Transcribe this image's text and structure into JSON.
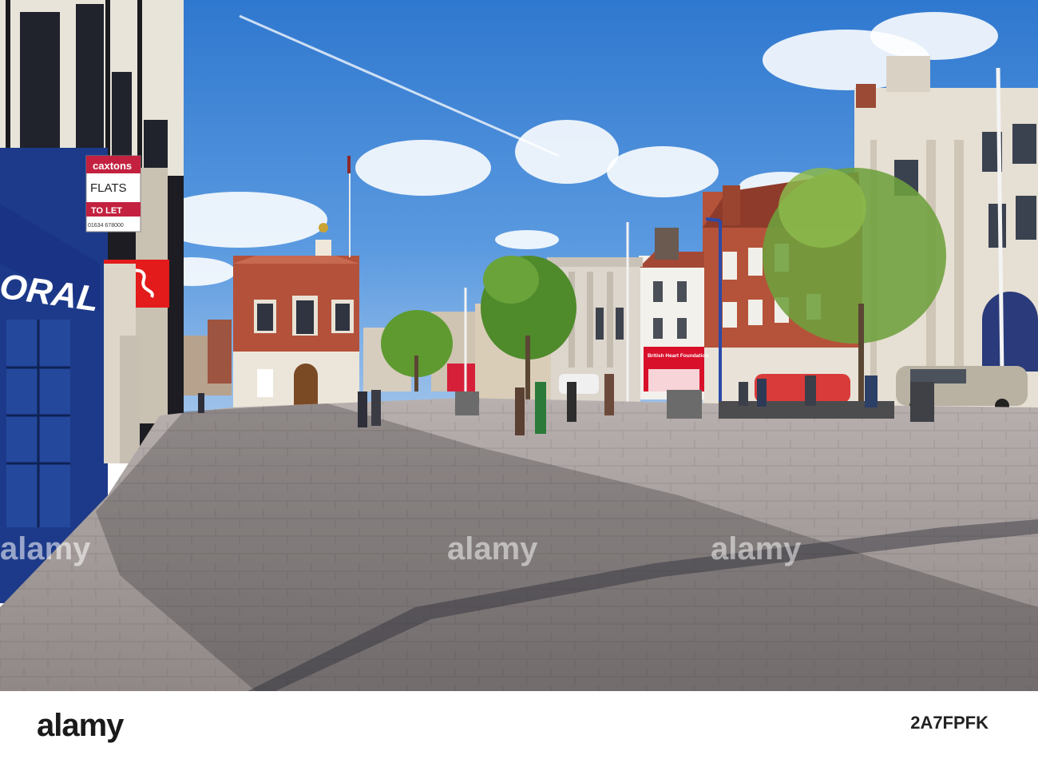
{
  "photo": {
    "signs": {
      "caxtons_brand": "caxtons",
      "caxtons_flats": "FLATS",
      "caxtons_tolet": "TO LET",
      "caxtons_phone": "01634 678000",
      "coral": "ORAL",
      "bhf": "British Heart Foundation"
    },
    "watermarks": [
      "alamy",
      "alamy",
      "alamy"
    ]
  },
  "footer": {
    "brand": "alamy",
    "image_id": "2A7FPFK"
  },
  "colors": {
    "sky": "#3f87d4",
    "coral_blue": "#1d3a8a",
    "santander_red": "#e31b1b",
    "bhf_red": "#d8102a",
    "brick": "#b5533a",
    "paving": "#a8a3a3"
  }
}
